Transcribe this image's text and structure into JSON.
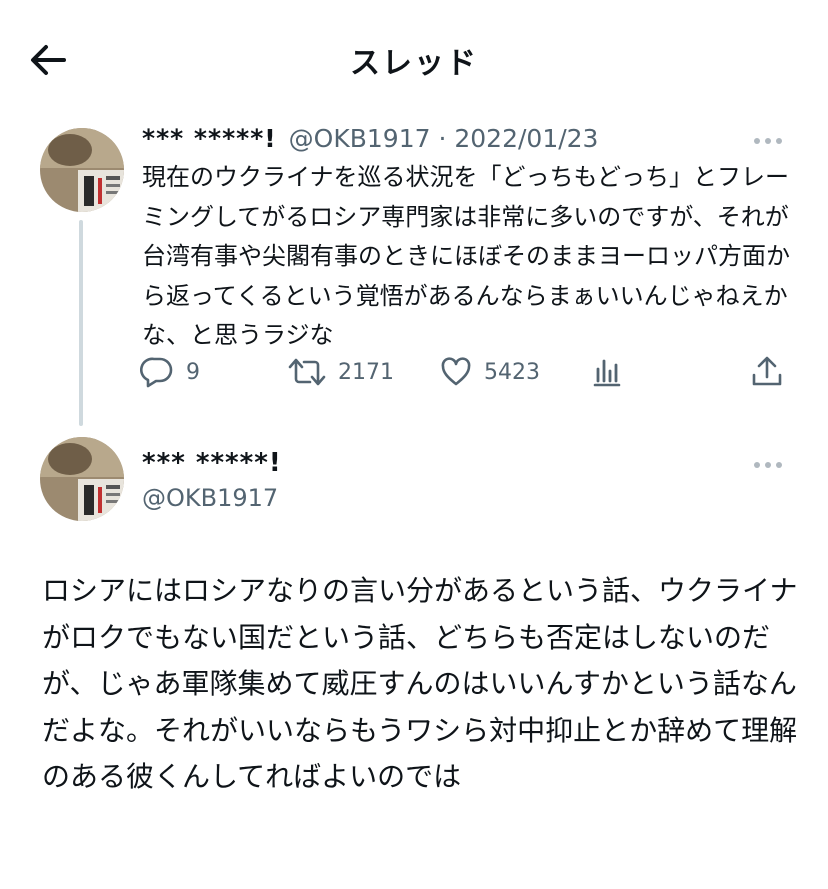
{
  "header": {
    "title": "スレッド",
    "back_icon": "arrow-left-icon"
  },
  "reply_tweet": {
    "author_name": "*** *****!",
    "handle": "@OKB1917",
    "date": "2022/01/23",
    "text": "現在のウクライナを巡る状況を「どっちもどっち」とフレーミングしてがるロシア専門家は非常に多いのですが、それが台湾有事や尖閣有事のときにほぼそのままヨーロッパ方面から返ってくるという覚悟があるんならまぁいいんじゃねえかな、と思うラジな",
    "stats": {
      "replies": "9",
      "retweets": "2171",
      "likes": "5423"
    }
  },
  "main_tweet": {
    "author_name": "*** *****!",
    "handle": "@OKB1917",
    "text": "ロシアにはロシアなりの言い分があるという話、ウクライナがロクでもない国だという話、どちらも否定はしないのだが、じゃあ軍隊集めて威圧すんのはいいんすかという話なんだよな。それがいいならもうワシら対中抑止とか辞めて理解のある彼くんしてればよいのでは"
  },
  "colors": {
    "text": "#0f1419",
    "secondary": "#536471",
    "thread_line": "#cfd9de"
  }
}
